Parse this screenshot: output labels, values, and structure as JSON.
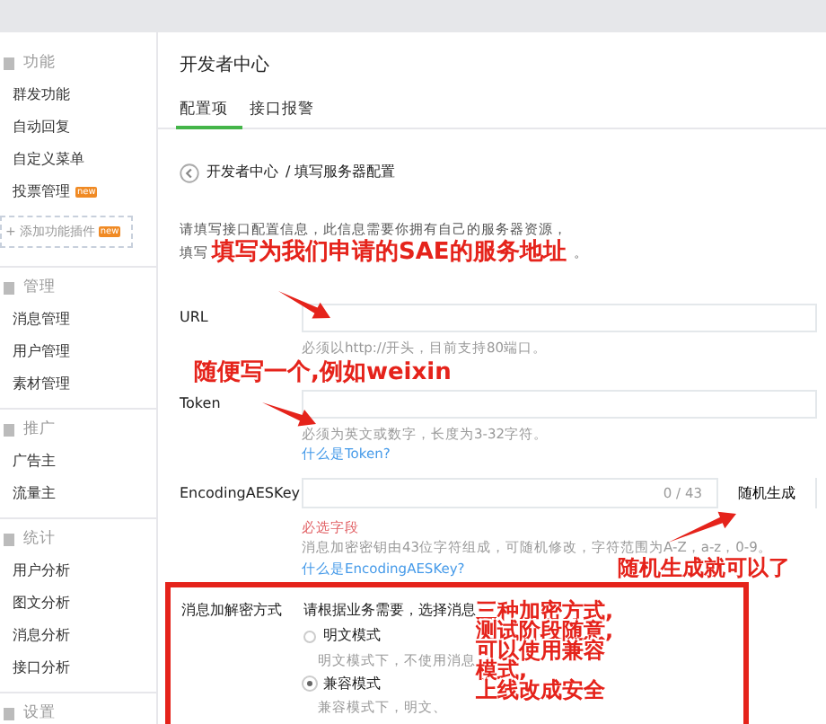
{
  "sidebar": {
    "sections": [
      {
        "title": "功能",
        "items": [
          {
            "label": "群发功能"
          },
          {
            "label": "自动回复"
          },
          {
            "label": "自定义菜单"
          },
          {
            "label": "投票管理",
            "badge": "new"
          }
        ],
        "add_plugin": {
          "icon": "+",
          "label": "添加功能插件",
          "badge": "new"
        }
      },
      {
        "title": "管理",
        "items": [
          {
            "label": "消息管理"
          },
          {
            "label": "用户管理"
          },
          {
            "label": "素材管理"
          }
        ]
      },
      {
        "title": "推广",
        "items": [
          {
            "label": "广告主"
          },
          {
            "label": "流量主"
          }
        ]
      },
      {
        "title": "统计",
        "items": [
          {
            "label": "用户分析"
          },
          {
            "label": "图文分析"
          },
          {
            "label": "消息分析"
          },
          {
            "label": "接口分析"
          }
        ]
      },
      {
        "title": "设置"
      }
    ]
  },
  "page_title": "开发者中心",
  "tabs": [
    {
      "label": "配置项",
      "selected": true
    },
    {
      "label": "接口报警",
      "selected": false
    }
  ],
  "breadcrumb": {
    "parent": "开发者中心",
    "current": "/ 填写服务器配置"
  },
  "intro": {
    "lines": [
      "请填写接口配置信息，此信息需要你拥有自己的服务器资源，",
      "填写"
    ],
    "end": "。",
    "note": "填写为我们申请的SAE的服务地址"
  },
  "url": {
    "label": "URL",
    "hint": "必须以http://开头，目前支持80端口。"
  },
  "token_note": "随便写一个,例如weixin",
  "token": {
    "label": "Token",
    "hint": "必须为英文或数字，长度为3-32字符。",
    "link": "什么是Token?"
  },
  "aes": {
    "label": "EncodingAESKey",
    "counter": "0 / 43",
    "button": "随机生成",
    "error": "必选字段",
    "hint": "消息加密密钥由43位字符组成，可随机修改，字符范围为A-Z，a-z，0-9。",
    "link": "什么是EncodingAESKey?",
    "note": "随机生成就可以了"
  },
  "encryption": {
    "label": "消息加解密方式",
    "prompt": "请根据业务需要，选择消息",
    "options": [
      {
        "label": "明文模式",
        "selected": false,
        "desc": "明文模式下，不使用消息"
      },
      {
        "label": "兼容模式",
        "selected": true,
        "desc": "兼容模式下，明文、"
      }
    ],
    "note": [
      "三种加密方式,",
      "测试阶段随意,",
      "可以使用兼容",
      "模式,",
      "上线改成安全"
    ]
  }
}
